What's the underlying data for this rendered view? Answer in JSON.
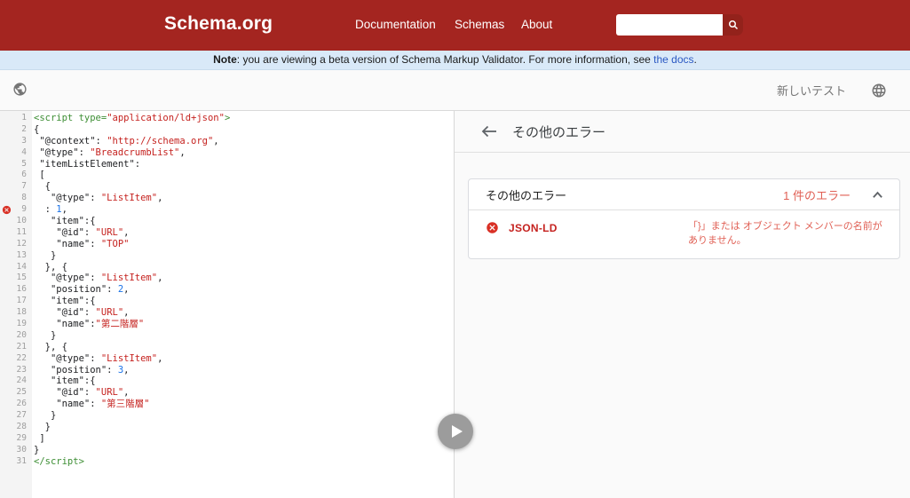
{
  "header": {
    "title": "Schema.org",
    "nav": [
      "Documentation",
      "Schemas",
      "About"
    ]
  },
  "banner": {
    "note": "Note",
    "text": ": you are viewing a beta version of Schema Markup Validator. For more information, see ",
    "link": "the docs",
    "period": "."
  },
  "toolbar": {
    "new_test": "新しいテスト"
  },
  "editor": {
    "lines": [
      {
        "no": 1,
        "error": false,
        "segments": [
          [
            "tag",
            "<script "
          ],
          [
            "tag",
            "type="
          ],
          [
            "str",
            "\"application/ld+json\""
          ],
          [
            "tag",
            ">"
          ]
        ]
      },
      {
        "no": 2,
        "error": false,
        "segments": [
          [
            "pln",
            "{"
          ]
        ]
      },
      {
        "no": 3,
        "error": false,
        "segments": [
          [
            "pln",
            " \"@context\": "
          ],
          [
            "str",
            "\"http://schema.org\""
          ],
          [
            "pln",
            ","
          ]
        ]
      },
      {
        "no": 4,
        "error": false,
        "segments": [
          [
            "pln",
            " \"@type\": "
          ],
          [
            "str",
            "\"BreadcrumbList\""
          ],
          [
            "pln",
            ","
          ]
        ]
      },
      {
        "no": 5,
        "error": false,
        "segments": [
          [
            "pln",
            " \"itemListElement\":"
          ]
        ]
      },
      {
        "no": 6,
        "error": false,
        "segments": [
          [
            "pln",
            " ["
          ]
        ]
      },
      {
        "no": 7,
        "error": false,
        "segments": [
          [
            "pln",
            "  {"
          ]
        ]
      },
      {
        "no": 8,
        "error": false,
        "segments": [
          [
            "pln",
            "   \"@type\": "
          ],
          [
            "str",
            "\"ListItem\""
          ],
          [
            "pln",
            ","
          ]
        ]
      },
      {
        "no": 9,
        "error": true,
        "segments": [
          [
            "pln",
            "  : "
          ],
          [
            "num",
            "1"
          ],
          [
            "pln",
            ","
          ]
        ]
      },
      {
        "no": 10,
        "error": false,
        "segments": [
          [
            "pln",
            "   \"item\":{"
          ]
        ]
      },
      {
        "no": 11,
        "error": false,
        "segments": [
          [
            "pln",
            "    \"@id\": "
          ],
          [
            "str",
            "\"URL\""
          ],
          [
            "pln",
            ","
          ]
        ]
      },
      {
        "no": 12,
        "error": false,
        "segments": [
          [
            "pln",
            "    \"name\": "
          ],
          [
            "str",
            "\"TOP\""
          ]
        ]
      },
      {
        "no": 13,
        "error": false,
        "segments": [
          [
            "pln",
            "   }"
          ]
        ]
      },
      {
        "no": 14,
        "error": false,
        "segments": [
          [
            "pln",
            "  }, {"
          ]
        ]
      },
      {
        "no": 15,
        "error": false,
        "segments": [
          [
            "pln",
            "   \"@type\": "
          ],
          [
            "str",
            "\"ListItem\""
          ],
          [
            "pln",
            ","
          ]
        ]
      },
      {
        "no": 16,
        "error": false,
        "segments": [
          [
            "pln",
            "   \"position\": "
          ],
          [
            "num",
            "2"
          ],
          [
            "pln",
            ","
          ]
        ]
      },
      {
        "no": 17,
        "error": false,
        "segments": [
          [
            "pln",
            "   \"item\":{"
          ]
        ]
      },
      {
        "no": 18,
        "error": false,
        "segments": [
          [
            "pln",
            "    \"@id\": "
          ],
          [
            "str",
            "\"URL\""
          ],
          [
            "pln",
            ","
          ]
        ]
      },
      {
        "no": 19,
        "error": false,
        "segments": [
          [
            "pln",
            "    \"name\":"
          ],
          [
            "str",
            "\"第二階層\""
          ]
        ]
      },
      {
        "no": 20,
        "error": false,
        "segments": [
          [
            "pln",
            "   }"
          ]
        ]
      },
      {
        "no": 21,
        "error": false,
        "segments": [
          [
            "pln",
            "  }, {"
          ]
        ]
      },
      {
        "no": 22,
        "error": false,
        "segments": [
          [
            "pln",
            "   \"@type\": "
          ],
          [
            "str",
            "\"ListItem\""
          ],
          [
            "pln",
            ","
          ]
        ]
      },
      {
        "no": 23,
        "error": false,
        "segments": [
          [
            "pln",
            "   \"position\": "
          ],
          [
            "num",
            "3"
          ],
          [
            "pln",
            ","
          ]
        ]
      },
      {
        "no": 24,
        "error": false,
        "segments": [
          [
            "pln",
            "   \"item\":{"
          ]
        ]
      },
      {
        "no": 25,
        "error": false,
        "segments": [
          [
            "pln",
            "    \"@id\": "
          ],
          [
            "str",
            "\"URL\""
          ],
          [
            "pln",
            ","
          ]
        ]
      },
      {
        "no": 26,
        "error": false,
        "segments": [
          [
            "pln",
            "    \"name\": "
          ],
          [
            "str",
            "\"第三階層\""
          ]
        ]
      },
      {
        "no": 27,
        "error": false,
        "segments": [
          [
            "pln",
            "   }"
          ]
        ]
      },
      {
        "no": 28,
        "error": false,
        "segments": [
          [
            "pln",
            "  }"
          ]
        ]
      },
      {
        "no": 29,
        "error": false,
        "segments": [
          [
            "pln",
            " ]"
          ]
        ]
      },
      {
        "no": 30,
        "error": false,
        "segments": [
          [
            "pln",
            "}"
          ]
        ]
      },
      {
        "no": 31,
        "error": false,
        "segments": [
          [
            "tag",
            "</script>"
          ]
        ]
      }
    ]
  },
  "results": {
    "title": "その他のエラー",
    "card": {
      "title": "その他のエラー",
      "count": "1 件のエラー",
      "rows": [
        {
          "format": "JSON-LD",
          "message": "「}」または オブジェクト メンバーの名前がありません。"
        }
      ]
    }
  },
  "colors": {
    "header_red": "#a42520",
    "search_button_red": "#93221b",
    "error_red": "#d93025",
    "string_red": "#c5221f",
    "number_blue": "#1a73e8",
    "tag_green": "#3d8e34",
    "link_blue": "#2b59c3",
    "banner_blue": "#d9e9f8"
  }
}
